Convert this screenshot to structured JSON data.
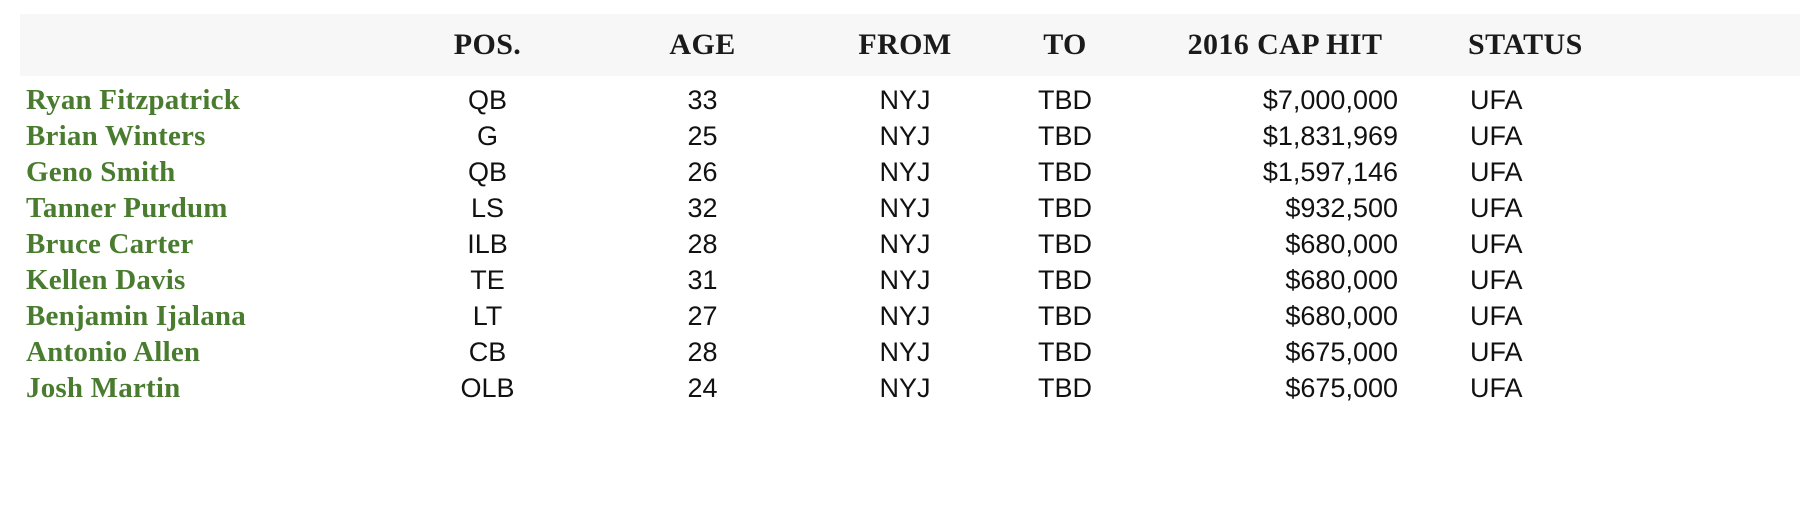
{
  "table": {
    "columns": [
      {
        "key": "name",
        "label": ""
      },
      {
        "key": "pos",
        "label": "POS."
      },
      {
        "key": "age",
        "label": "AGE"
      },
      {
        "key": "from",
        "label": "FROM"
      },
      {
        "key": "to",
        "label": "TO"
      },
      {
        "key": "cap",
        "label": "2016 CAP HIT"
      },
      {
        "key": "status",
        "label": "STATUS"
      }
    ],
    "rows": [
      {
        "name": "Ryan Fitzpatrick",
        "pos": "QB",
        "age": "33",
        "from": "NYJ",
        "to": "TBD",
        "cap": "$7,000,000",
        "status": "UFA"
      },
      {
        "name": "Brian Winters",
        "pos": "G",
        "age": "25",
        "from": "NYJ",
        "to": "TBD",
        "cap": "$1,831,969",
        "status": "UFA"
      },
      {
        "name": "Geno Smith",
        "pos": "QB",
        "age": "26",
        "from": "NYJ",
        "to": "TBD",
        "cap": "$1,597,146",
        "status": "UFA"
      },
      {
        "name": "Tanner Purdum",
        "pos": "LS",
        "age": "32",
        "from": "NYJ",
        "to": "TBD",
        "cap": "$932,500",
        "status": "UFA"
      },
      {
        "name": "Bruce Carter",
        "pos": "ILB",
        "age": "28",
        "from": "NYJ",
        "to": "TBD",
        "cap": "$680,000",
        "status": "UFA"
      },
      {
        "name": "Kellen Davis",
        "pos": "TE",
        "age": "31",
        "from": "NYJ",
        "to": "TBD",
        "cap": "$680,000",
        "status": "UFA"
      },
      {
        "name": "Benjamin Ijalana",
        "pos": "LT",
        "age": "27",
        "from": "NYJ",
        "to": "TBD",
        "cap": "$680,000",
        "status": "UFA"
      },
      {
        "name": "Antonio Allen",
        "pos": "CB",
        "age": "28",
        "from": "NYJ",
        "to": "TBD",
        "cap": "$675,000",
        "status": "UFA"
      },
      {
        "name": "Josh Martin",
        "pos": "OLB",
        "age": "24",
        "from": "NYJ",
        "to": "TBD",
        "cap": "$675,000",
        "status": "UFA"
      }
    ]
  },
  "colors": {
    "player_name": "#4a7c2f",
    "header_background": "#f7f7f7",
    "body_text": "#111111",
    "page_background": "#ffffff"
  }
}
